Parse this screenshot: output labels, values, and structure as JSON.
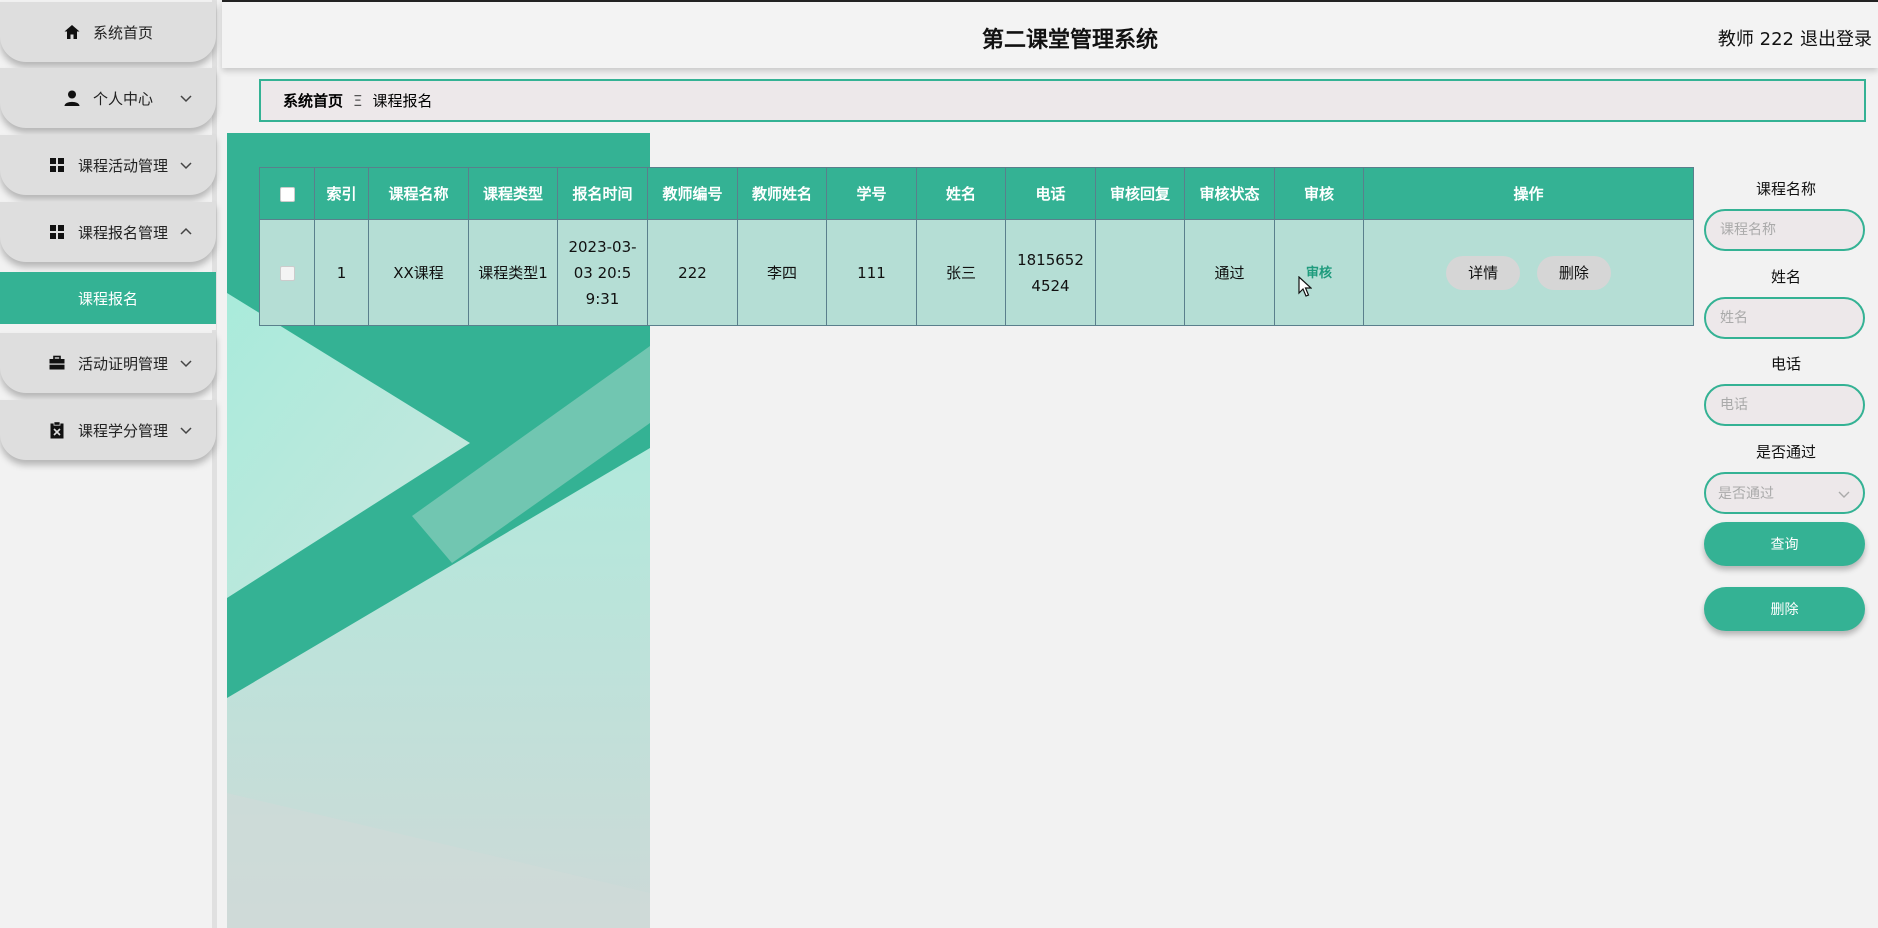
{
  "header": {
    "title": "第二课堂管理系统",
    "user": "教师 222",
    "logout": "退出登录"
  },
  "sidebar": {
    "items": [
      {
        "label": "系统首页",
        "icon": "home-icon"
      },
      {
        "label": "个人中心",
        "icon": "user-icon"
      },
      {
        "label": "课程活动管理",
        "icon": "grid-icon"
      },
      {
        "label": "课程报名管理",
        "icon": "grid-icon"
      },
      {
        "label": "活动证明管理",
        "icon": "briefcase-icon"
      },
      {
        "label": "课程学分管理",
        "icon": "clipboard-icon"
      }
    ],
    "active_sub": "课程报名"
  },
  "breadcrumb": {
    "home": "系统首页",
    "separator": "Ξ",
    "current": "课程报名"
  },
  "table": {
    "columns": [
      "索引",
      "课程名称",
      "课程类型",
      "报名时间",
      "教师编号",
      "教师姓名",
      "学号",
      "姓名",
      "电话",
      "审核回复",
      "审核状态",
      "审核",
      "操作"
    ],
    "rows": [
      {
        "index": "1",
        "course_name": "XX课程",
        "course_type": "课程类型1",
        "signup_time": "2023-03-03 20:59:31",
        "teacher_no": "222",
        "teacher_name": "李四",
        "student_no": "111",
        "name": "张三",
        "phone": "18156524524",
        "reply": "",
        "status": "通过",
        "audit": "审核",
        "detail": "详情",
        "delete": "删除"
      }
    ]
  },
  "search": {
    "course_label": "课程名称",
    "course_placeholder": "课程名称",
    "name_label": "姓名",
    "name_placeholder": "姓名",
    "phone_label": "电话",
    "phone_placeholder": "电话",
    "pass_label": "是否通过",
    "pass_placeholder": "是否通过",
    "query_button": "查询",
    "delete_button": "删除"
  },
  "colors": {
    "accent": "#34b294",
    "row_bg": "#b5ded5",
    "breadcrumb_bg": "#ede8ea"
  }
}
